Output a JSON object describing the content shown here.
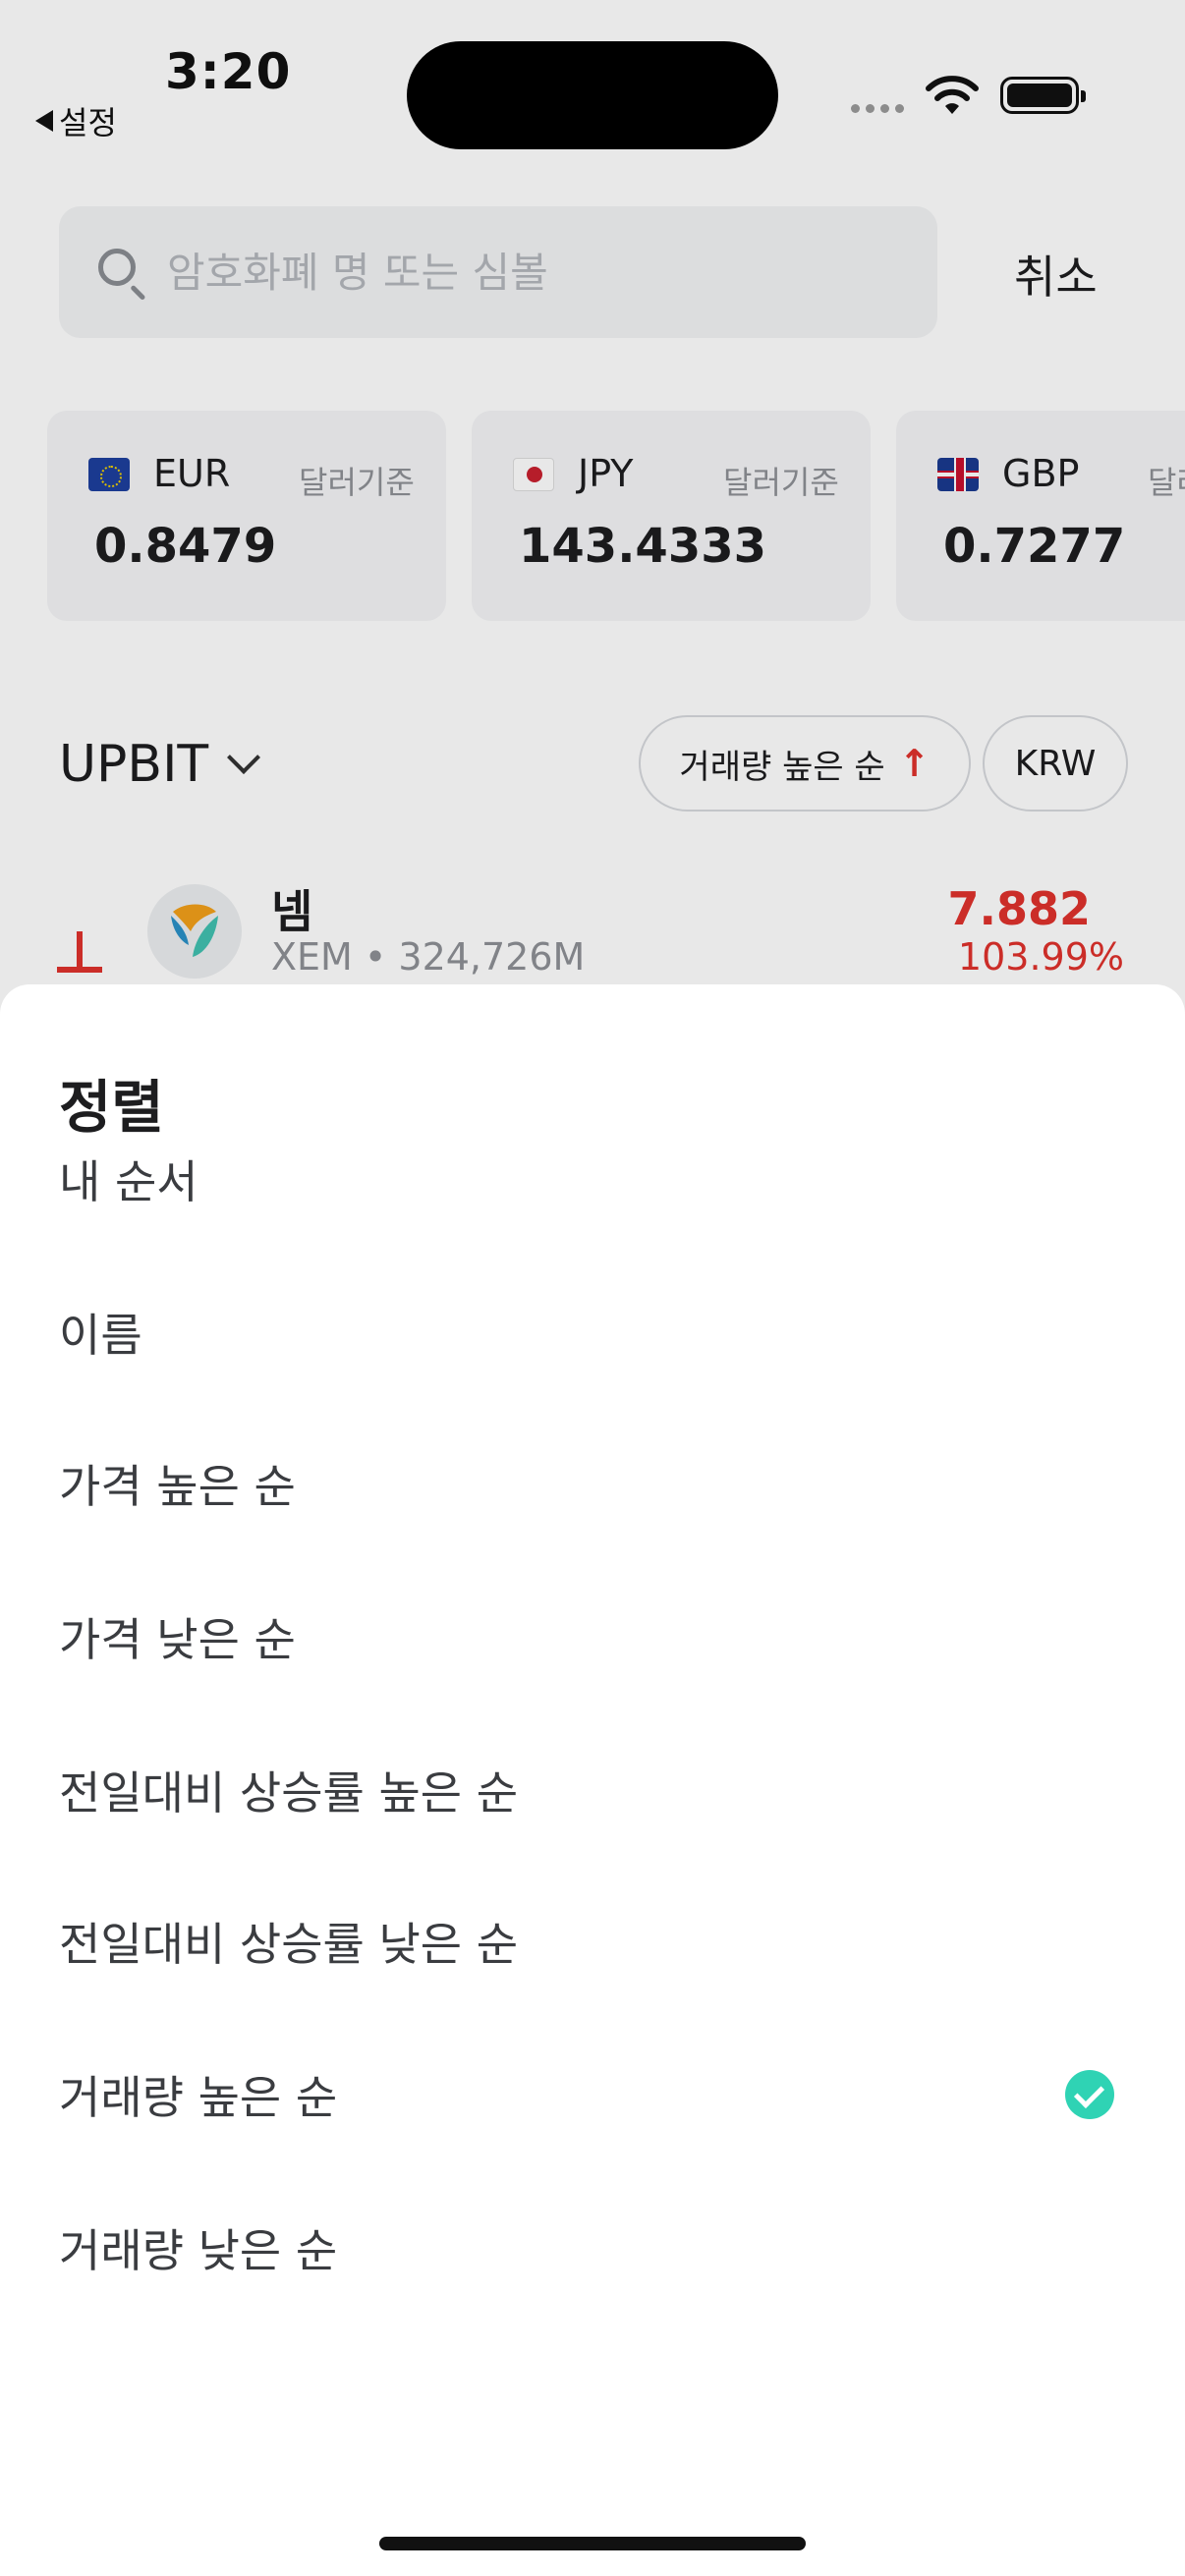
{
  "status_bar": {
    "time": "3:20",
    "back_app": "설정"
  },
  "search": {
    "placeholder": "암호화폐 명 또는 심볼",
    "cancel_label": "취소"
  },
  "fx_cards": [
    {
      "flag": "eu-flag-icon",
      "code": "EUR",
      "basis": "달러기준",
      "value": "0.8479"
    },
    {
      "flag": "jp-flag-icon",
      "code": "JPY",
      "basis": "달러기준",
      "value": "143.4333"
    },
    {
      "flag": "gb-flag-icon",
      "code": "GBP",
      "basis": "달러",
      "value": "0.7277"
    }
  ],
  "market": {
    "exchange": "UPBIT",
    "sort_label": "거래량 높은 순",
    "sort_arrow": "↑",
    "currency": "KRW"
  },
  "coin": {
    "name": "넴",
    "meta": "XEM • 324,726M",
    "price": "7.882",
    "change": "103.99%"
  },
  "sort_sheet": {
    "title": "정렬",
    "options": [
      {
        "label": "내 순서",
        "selected": false
      },
      {
        "label": "이름",
        "selected": false
      },
      {
        "label": "가격 높은 순",
        "selected": false
      },
      {
        "label": "가격 낮은 순",
        "selected": false
      },
      {
        "label": "전일대비 상승률 높은 순",
        "selected": false
      },
      {
        "label": "전일대비 상승률 낮은 순",
        "selected": false
      },
      {
        "label": "거래량 높은 순",
        "selected": true
      },
      {
        "label": "거래량 낮은 순",
        "selected": false
      }
    ]
  },
  "colors": {
    "accent_check": "#2fd3b4",
    "rise_red": "#e0322c"
  }
}
